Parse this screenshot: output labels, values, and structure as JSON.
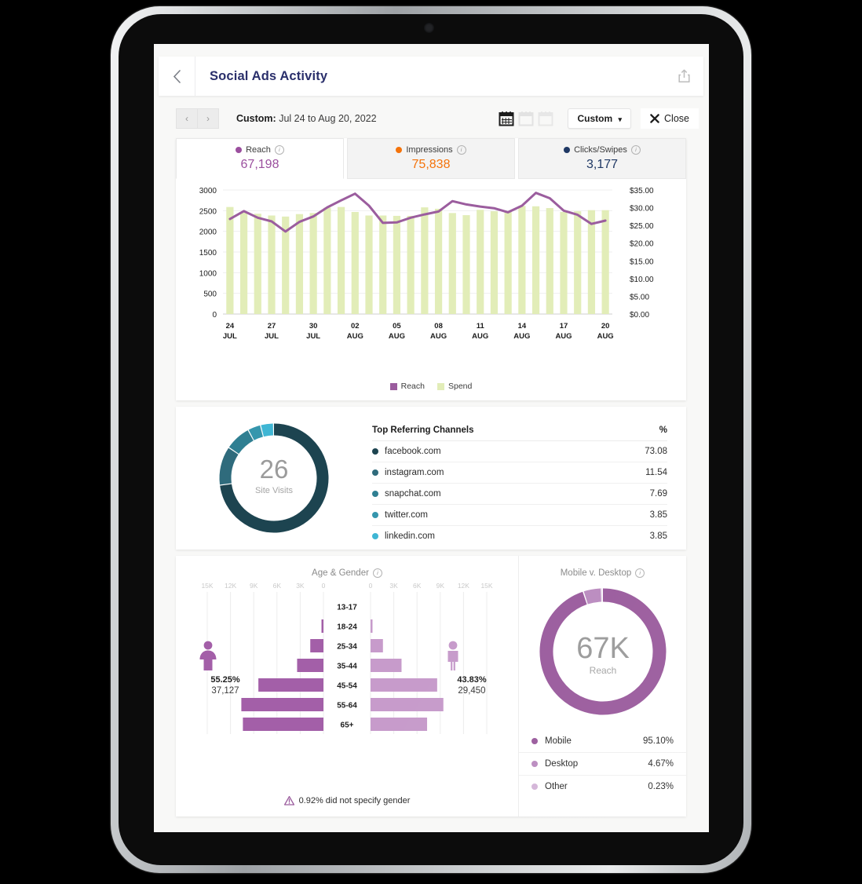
{
  "header": {
    "back_icon": "chevron-left-icon",
    "title": "Social Ads Activity",
    "share_icon": "share-icon"
  },
  "toolbar": {
    "prev_label": "‹",
    "next_label": "›",
    "range_prefix": "Custom:",
    "range_value": "Jul 24 to Aug 20, 2022",
    "view_icons": [
      "calendar-day-icon",
      "calendar-week-icon",
      "calendar-month-icon"
    ],
    "select_label": "Custom",
    "select_caret": "▾",
    "close_label": "Close",
    "close_icon": "close-icon"
  },
  "metric_tabs": [
    {
      "label": "Reach",
      "value": "67,198",
      "color": "#9b4f9e",
      "active": true
    },
    {
      "label": "Impressions",
      "value": "75,838",
      "color": "#f4730b",
      "active": false
    },
    {
      "label": "Clicks/Swipes",
      "value": "3,177",
      "color": "#1f3864",
      "active": false
    }
  ],
  "chart_data": {
    "type": "bar",
    "title": "",
    "xlabel": "",
    "ylabel": "Reach",
    "y2label": "Spend",
    "ylim": [
      0,
      3000
    ],
    "y2lim": [
      0,
      35
    ],
    "yticks": [
      "0",
      "500",
      "1000",
      "1500",
      "2000",
      "2500",
      "3000"
    ],
    "y2ticks": [
      "$0.00",
      "$5.00",
      "$10.00",
      "$15.00",
      "$20.00",
      "$25.00",
      "$30.00",
      "$35.00"
    ],
    "grid": true,
    "legend": [
      {
        "name": "Reach",
        "color": "#9b5d9e"
      },
      {
        "name": "Spend",
        "color": "#e2edb8"
      }
    ],
    "x": [
      "24 JUL",
      "25 JUL",
      "26 JUL",
      "27 JUL",
      "28 JUL",
      "29 JUL",
      "30 JUL",
      "31 JUL",
      "01 AUG",
      "02 AUG",
      "03 AUG",
      "04 AUG",
      "05 AUG",
      "06 AUG",
      "07 AUG",
      "08 AUG",
      "09 AUG",
      "10 AUG",
      "11 AUG",
      "12 AUG",
      "13 AUG",
      "14 AUG",
      "15 AUG",
      "16 AUG",
      "17 AUG",
      "18 AUG",
      "19 AUG",
      "20 AUG"
    ],
    "xtick_labels": [
      {
        "index": 0,
        "day": "24",
        "month": "JUL"
      },
      {
        "index": 3,
        "day": "27",
        "month": "JUL"
      },
      {
        "index": 6,
        "day": "30",
        "month": "JUL"
      },
      {
        "index": 9,
        "day": "02",
        "month": "AUG"
      },
      {
        "index": 12,
        "day": "05",
        "month": "AUG"
      },
      {
        "index": 15,
        "day": "08",
        "month": "AUG"
      },
      {
        "index": 18,
        "day": "11",
        "month": "AUG"
      },
      {
        "index": 21,
        "day": "14",
        "month": "AUG"
      },
      {
        "index": 24,
        "day": "17",
        "month": "AUG"
      },
      {
        "index": 27,
        "day": "20",
        "month": "AUG"
      }
    ],
    "series": [
      {
        "name": "Spend",
        "type": "bar",
        "axis": "right",
        "color": "#e2edb8",
        "values": [
          30.2,
          28.8,
          28.3,
          27.8,
          27.5,
          28.2,
          28.5,
          30.0,
          30.2,
          28.8,
          27.8,
          27.8,
          27.7,
          27.7,
          30.1,
          29.7,
          28.5,
          27.9,
          29.4,
          29.0,
          28.9,
          30.5,
          30.4,
          29.9,
          28.8,
          29.0,
          29.3,
          29.3
        ]
      },
      {
        "name": "Reach",
        "type": "line",
        "axis": "left",
        "color": "#9b5d9e",
        "values": [
          2300,
          2490,
          2330,
          2240,
          1995,
          2230,
          2360,
          2580,
          2750,
          2910,
          2620,
          2205,
          2215,
          2330,
          2410,
          2480,
          2730,
          2650,
          2600,
          2560,
          2460,
          2620,
          2930,
          2800,
          2500,
          2400,
          2180,
          2260
        ]
      }
    ]
  },
  "site_visits": {
    "value": "26",
    "caption": "Site Visits",
    "segments": [
      {
        "label": "facebook.com",
        "pct": 73.08,
        "color": "#1d4450"
      },
      {
        "label": "instagram.com",
        "pct": 11.54,
        "color": "#2f6b7c"
      },
      {
        "label": "snapchat.com",
        "pct": 7.69,
        "color": "#2f7f92"
      },
      {
        "label": "twitter.com",
        "pct": 3.85,
        "color": "#3596ad"
      },
      {
        "label": "linkedin.com",
        "pct": 3.85,
        "color": "#3fb6d4"
      }
    ]
  },
  "channels": {
    "title": "Top Referring Channels",
    "pct_header": "%",
    "rows": [
      {
        "name": "facebook.com",
        "pct": "73.08",
        "color": "#1d4450"
      },
      {
        "name": "instagram.com",
        "pct": "11.54",
        "color": "#2f6b7c"
      },
      {
        "name": "snapchat.com",
        "pct": "7.69",
        "color": "#2f7f92"
      },
      {
        "name": "twitter.com",
        "pct": "3.85",
        "color": "#3596ad"
      },
      {
        "name": "linkedin.com",
        "pct": "3.85",
        "color": "#3fb6d4"
      }
    ]
  },
  "age_gender": {
    "title": "Age & Gender",
    "info_icon": "info-icon",
    "axis_ticks_left": [
      "15K",
      "12K",
      "9K",
      "6K",
      "3K",
      "0"
    ],
    "axis_ticks_right": [
      "0",
      "3K",
      "6K",
      "9K",
      "12K",
      "15K"
    ],
    "axis_max": 15000,
    "female": {
      "icon": "female-icon",
      "pct": "55.25%",
      "count": "37,127",
      "color": "#a35fa8"
    },
    "male": {
      "icon": "male-icon",
      "pct": "43.83%",
      "count": "29,450",
      "color": "#c79bcb"
    },
    "brackets": [
      {
        "label": "13-17",
        "female": 0,
        "male": 0
      },
      {
        "label": "18-24",
        "female": 250,
        "male": 250
      },
      {
        "label": "25-34",
        "female": 1700,
        "male": 1600
      },
      {
        "label": "35-44",
        "female": 3400,
        "male": 4000
      },
      {
        "label": "45-54",
        "female": 8400,
        "male": 8600
      },
      {
        "label": "55-64",
        "female": 10600,
        "male": 9400
      },
      {
        "label": "65+",
        "female": 10400,
        "male": 7300
      }
    ],
    "disclaimer": "0.92% did not specify gender",
    "warn_icon": "warning-icon"
  },
  "mobile_desktop": {
    "title": "Mobile v. Desktop",
    "info_icon": "info-icon",
    "center_value": "67K",
    "center_caption": "Reach",
    "rows": [
      {
        "name": "Mobile",
        "pct": "95.10%",
        "value": 95.1,
        "color": "#9b5d9e"
      },
      {
        "name": "Desktop",
        "pct": "4.67%",
        "value": 4.67,
        "color": "#bb8cc0"
      },
      {
        "name": "Other",
        "pct": "0.23%",
        "value": 0.23,
        "color": "#d4b5d8"
      }
    ]
  }
}
